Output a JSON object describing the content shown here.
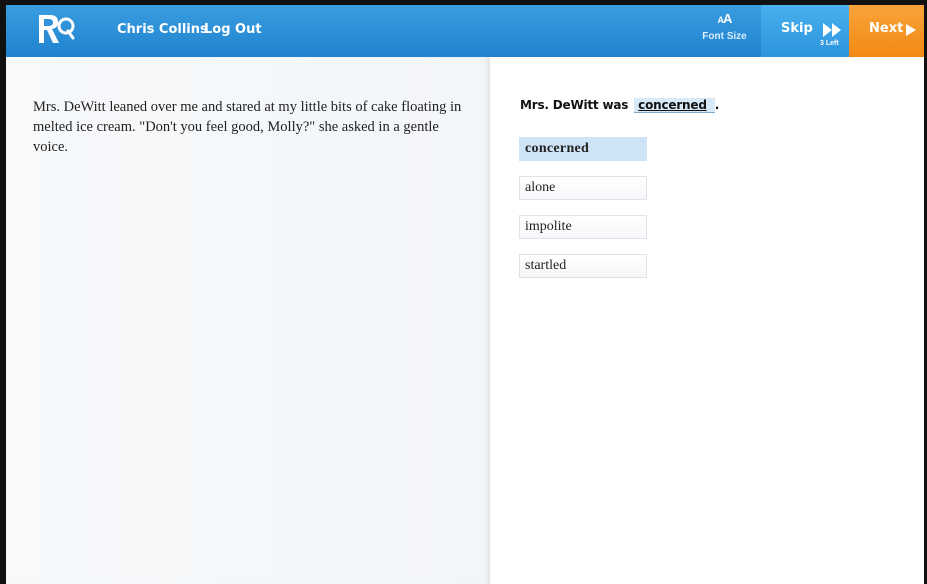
{
  "header": {
    "logo_text": "RQ",
    "user_name": "Chris Collins",
    "logout_label": "Log Out",
    "font_size": {
      "glyph_small": "A",
      "glyph_large": "A",
      "label": "Font Size"
    },
    "skip": {
      "label": "Skip",
      "remaining": "3 Left"
    },
    "next": {
      "label": "Next"
    }
  },
  "passage": {
    "text": "Mrs. DeWitt leaned over me and stared at my little bits of cake floating in melted ice cream. \"Don't you feel good, Molly?\" she asked in a gentle voice."
  },
  "question": {
    "prefix": "Mrs. DeWitt was",
    "answer": "concerned",
    "suffix": "."
  },
  "choices": [
    {
      "label": "concerned",
      "selected": true
    },
    {
      "label": "alone",
      "selected": false
    },
    {
      "label": "impolite",
      "selected": false
    },
    {
      "label": "startled",
      "selected": false
    }
  ],
  "colors": {
    "header_blue": "#2a8fd8",
    "skip_blue": "#3aa3e6",
    "next_orange": "#f5961f",
    "selected_choice": "#cfe3f6"
  }
}
